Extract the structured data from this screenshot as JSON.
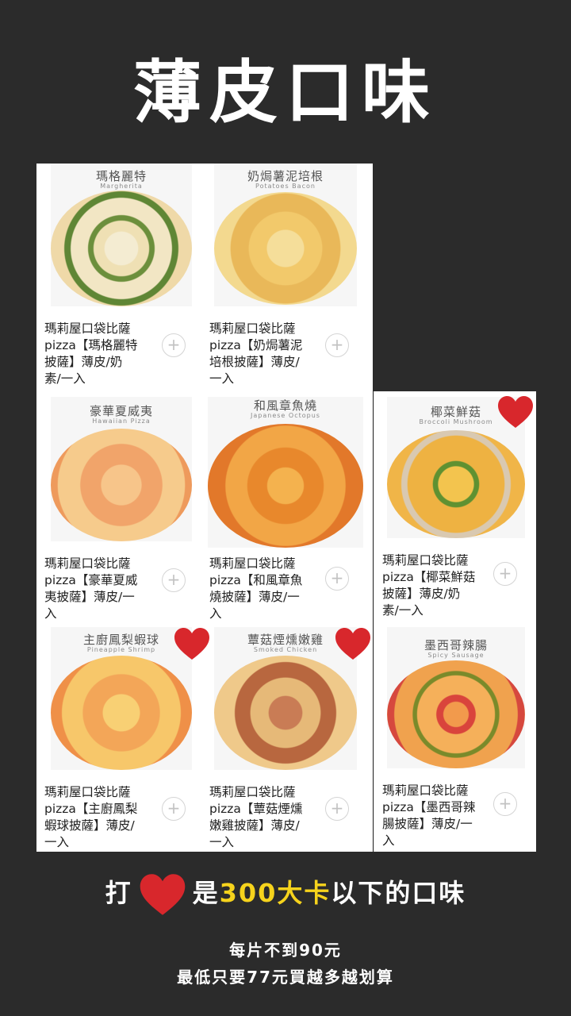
{
  "title": "薄皮口味",
  "plus_glyph": "+",
  "heart_color": "#d8272c",
  "highlight_color": "#f6d31c",
  "items": [
    {
      "cn": "瑪格麗特",
      "en": "Margherita",
      "name": "瑪莉屋口袋比薩\npizza【瑪格麗特\n披薩】薄皮/奶\n素/一入",
      "heart": false
    },
    {
      "cn": "奶焗薯泥培根",
      "en": "Potatoes Bacon",
      "name": "瑪莉屋口袋比薩\npizza【奶焗薯泥\n培根披薩】薄皮/\n一入",
      "heart": false
    },
    {
      "cn": "豪華夏威夷",
      "en": "Hawaiian Pizza",
      "name": "瑪莉屋口袋比薩\npizza【豪華夏威\n夷披薩】薄皮/一\n入",
      "heart": false
    },
    {
      "cn": "和風章魚燒",
      "en": "Japanese Octopus",
      "name": "瑪莉屋口袋比薩\npizza【和風章魚\n燒披薩】薄皮/一\n入",
      "heart": false
    },
    {
      "cn": "椰菜鮮菇",
      "en": "Broccoli Mushroom",
      "name": "瑪莉屋口袋比薩\npizza【椰菜鮮菇\n披薩】薄皮/奶\n素/一入",
      "heart": true
    },
    {
      "cn": "主廚鳳梨蝦球",
      "en": "Pineapple Shrimp",
      "name": "瑪莉屋口袋比薩\npizza【主廚鳳梨\n蝦球披薩】薄皮/\n一入",
      "heart": true
    },
    {
      "cn": "蕈菇煙燻嫩雞",
      "en": "Smoked Chicken",
      "name": "瑪莉屋口袋比薩\npizza【蕈菇煙燻\n嫩雞披薩】薄皮/\n一入",
      "heart": true
    },
    {
      "cn": "墨西哥辣腸",
      "en": "Spicy Sausage",
      "name": "瑪莉屋口袋比薩\npizza【墨西哥辣\n腸披薩】薄皮/一\n入",
      "heart": false
    }
  ],
  "legend": {
    "prefix": "打",
    "middle": "是",
    "highlight": "300大卡",
    "suffix": "以下的口味"
  },
  "footer": {
    "line1": "每片不到90元",
    "line2": "最低只要77元買越多越划算"
  }
}
